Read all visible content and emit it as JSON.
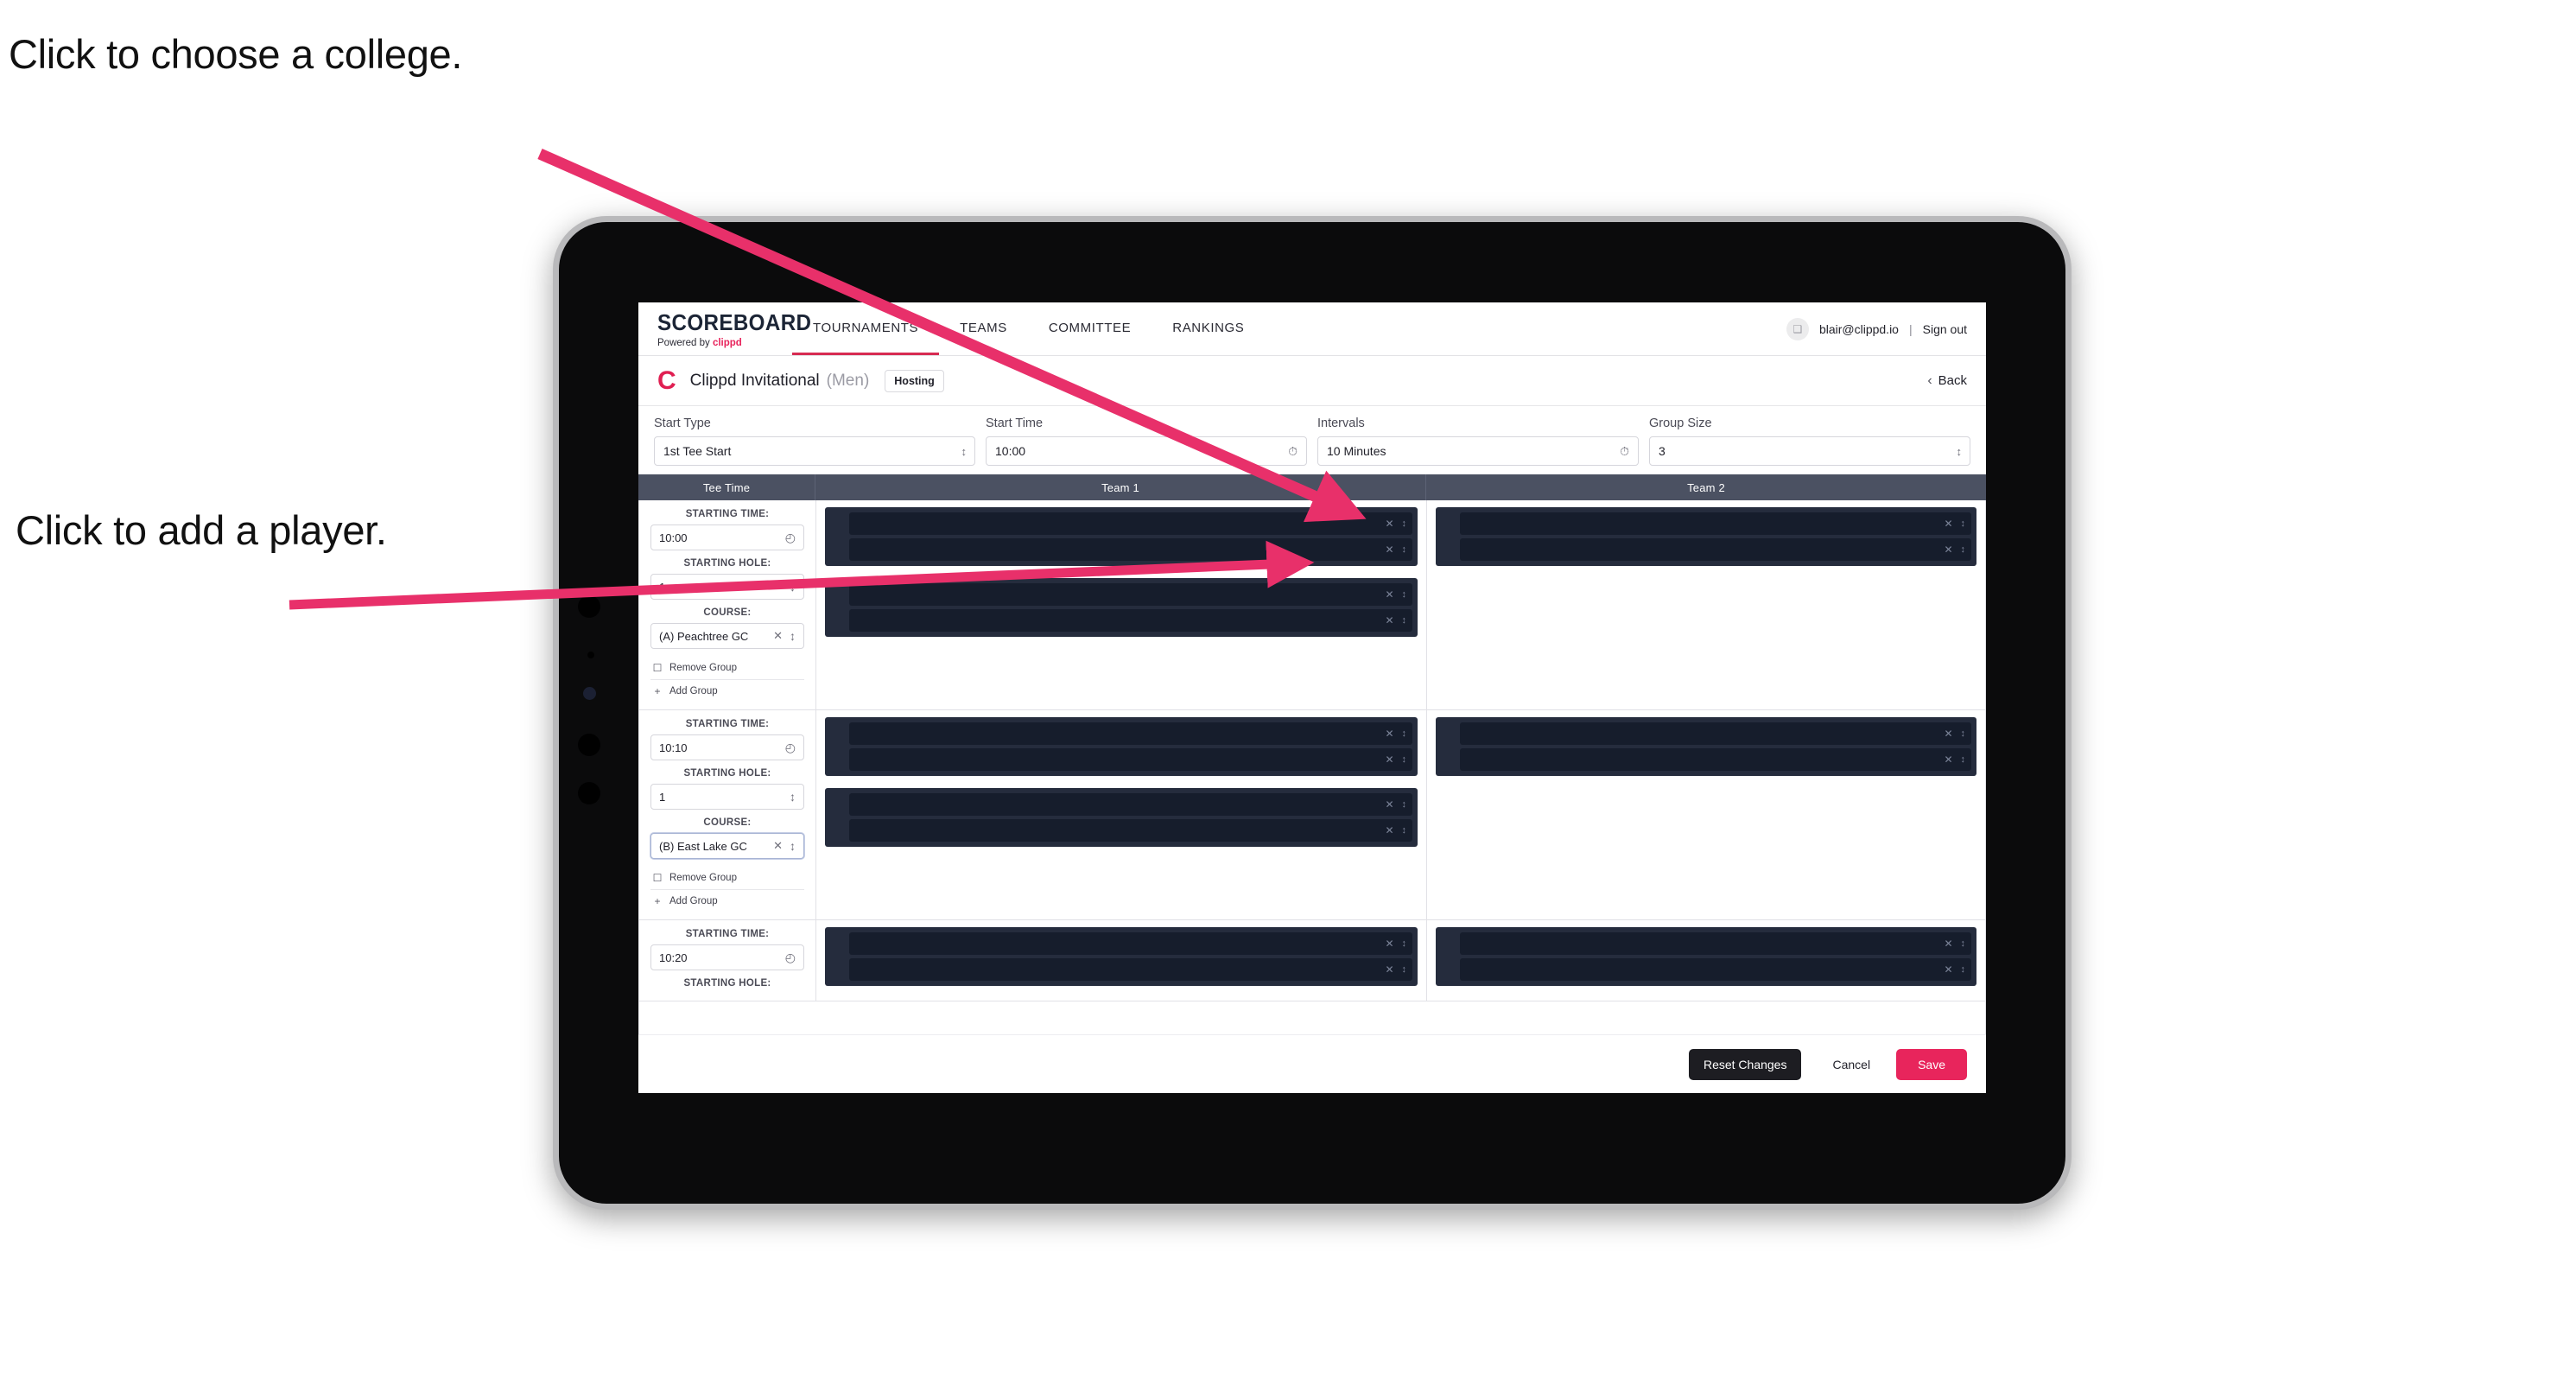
{
  "annotations": {
    "college": "Click to choose a college.",
    "player": "Click to add a player."
  },
  "colors": {
    "accent_pink": "#e8255c",
    "arrow_pink": "#e8306a",
    "nav_active": "#d72b51",
    "table_header_bg": "#4b5162",
    "player_card_bg": "#252c3d",
    "player_row_bg": "#161d2c"
  },
  "navbar": {
    "brand_title": "SCOREBOARD",
    "brand_sub_prefix": "Powered by ",
    "brand_sub_accent": "clippd",
    "links": [
      {
        "label": "TOURNAMENTS",
        "active": true
      },
      {
        "label": "TEAMS",
        "active": false
      },
      {
        "label": "COMMITTEE",
        "active": false
      },
      {
        "label": "RANKINGS",
        "active": false
      }
    ],
    "avatar_glyph": "❑",
    "email": "blair@clippd.io",
    "separator": "|",
    "sign_out": "Sign out"
  },
  "tournament": {
    "logo_letter": "C",
    "name": "Clippd Invitational",
    "gender": "(Men)",
    "badge": "Hosting",
    "back_chevron": "‹",
    "back_label": "Back"
  },
  "controls": [
    {
      "label": "Start Type",
      "value": "1st Tee Start",
      "icon": "updown-icon",
      "name": "start-type"
    },
    {
      "label": "Start Time",
      "value": "10:00",
      "icon": "clock-icon",
      "name": "start-time"
    },
    {
      "label": "Intervals",
      "value": "10 Minutes",
      "icon": "clock-icon",
      "name": "intervals"
    },
    {
      "label": "Group Size",
      "value": "3",
      "icon": "updown-icon",
      "name": "group-size"
    }
  ],
  "table": {
    "headers": {
      "tee_time": "Tee Time",
      "team1": "Team 1",
      "team2": "Team 2"
    },
    "labels": {
      "starting_time": "STARTING TIME:",
      "starting_hole": "STARTING HOLE:",
      "course": "COURSE:",
      "remove_group": "Remove Group",
      "add_group": "Add Group"
    },
    "icons": {
      "clock": "◴",
      "updown": "↕",
      "clear": "✕",
      "trash": "☐",
      "plus": "+"
    },
    "rows": [
      {
        "starting_time": "10:00",
        "starting_hole": "1",
        "course": "(A) Peachtree GC",
        "course_focused": false,
        "team1_groups": [
          {
            "players": 2,
            "indent": true
          },
          {
            "players": 2,
            "indent": true
          }
        ],
        "team2_groups": [
          {
            "players": 2,
            "indent": true
          }
        ]
      },
      {
        "starting_time": "10:10",
        "starting_hole": "1",
        "course": "(B) East Lake GC",
        "course_focused": true,
        "team1_groups": [
          {
            "players": 2,
            "indent": true
          },
          {
            "players": 2,
            "indent": true
          }
        ],
        "team2_groups": [
          {
            "players": 2,
            "indent": true
          }
        ]
      },
      {
        "starting_time": "10:20",
        "starting_hole": "",
        "course": "",
        "course_focused": false,
        "team1_groups": [
          {
            "players": 2,
            "indent": true
          }
        ],
        "team2_groups": [
          {
            "players": 2,
            "indent": true
          }
        ]
      }
    ]
  },
  "footer": {
    "reset": "Reset Changes",
    "cancel": "Cancel",
    "save": "Save"
  }
}
